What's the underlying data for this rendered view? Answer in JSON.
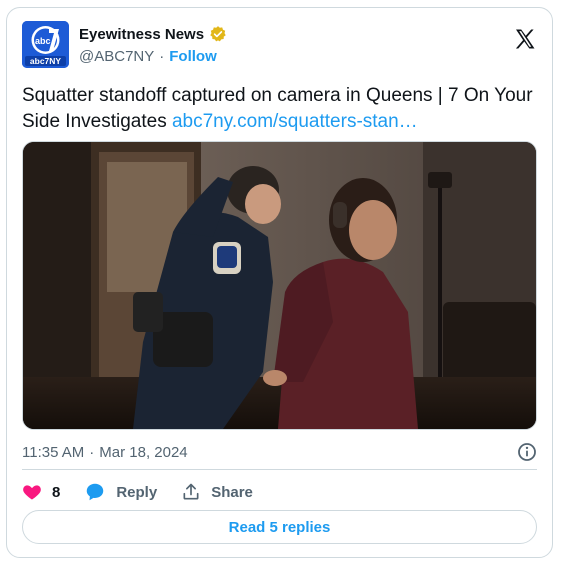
{
  "author": {
    "display_name": "Eyewitness News",
    "handle": "@ABC7NY",
    "separator": "·",
    "follow_label": "Follow",
    "avatar_text": "abc7NY",
    "verified": true
  },
  "tweet": {
    "text": "Squatter standoff captured on camera in Queens | 7 On Your Side Investigates ",
    "link_text": "abc7ny.com/squatters-stan…"
  },
  "meta": {
    "time": "11:35 AM",
    "separator": "·",
    "date": "Mar 18, 2024"
  },
  "actions": {
    "like_count": "8",
    "reply_label": "Reply",
    "share_label": "Share"
  },
  "replies_button_label": "Read 5 replies",
  "colors": {
    "accent": "#1d9bf0",
    "like": "#f91880",
    "verified_gold": "#e2b719",
    "text_primary": "#0f1419",
    "text_secondary": "#536471",
    "border": "#cfd9de",
    "avatar_bg": "#1d5bd6"
  },
  "icons": {
    "platform": "x-logo-icon",
    "verified": "verified-badge-icon",
    "info": "info-icon",
    "like": "heart-icon",
    "reply": "reply-bubble-icon",
    "share": "share-upload-icon"
  }
}
